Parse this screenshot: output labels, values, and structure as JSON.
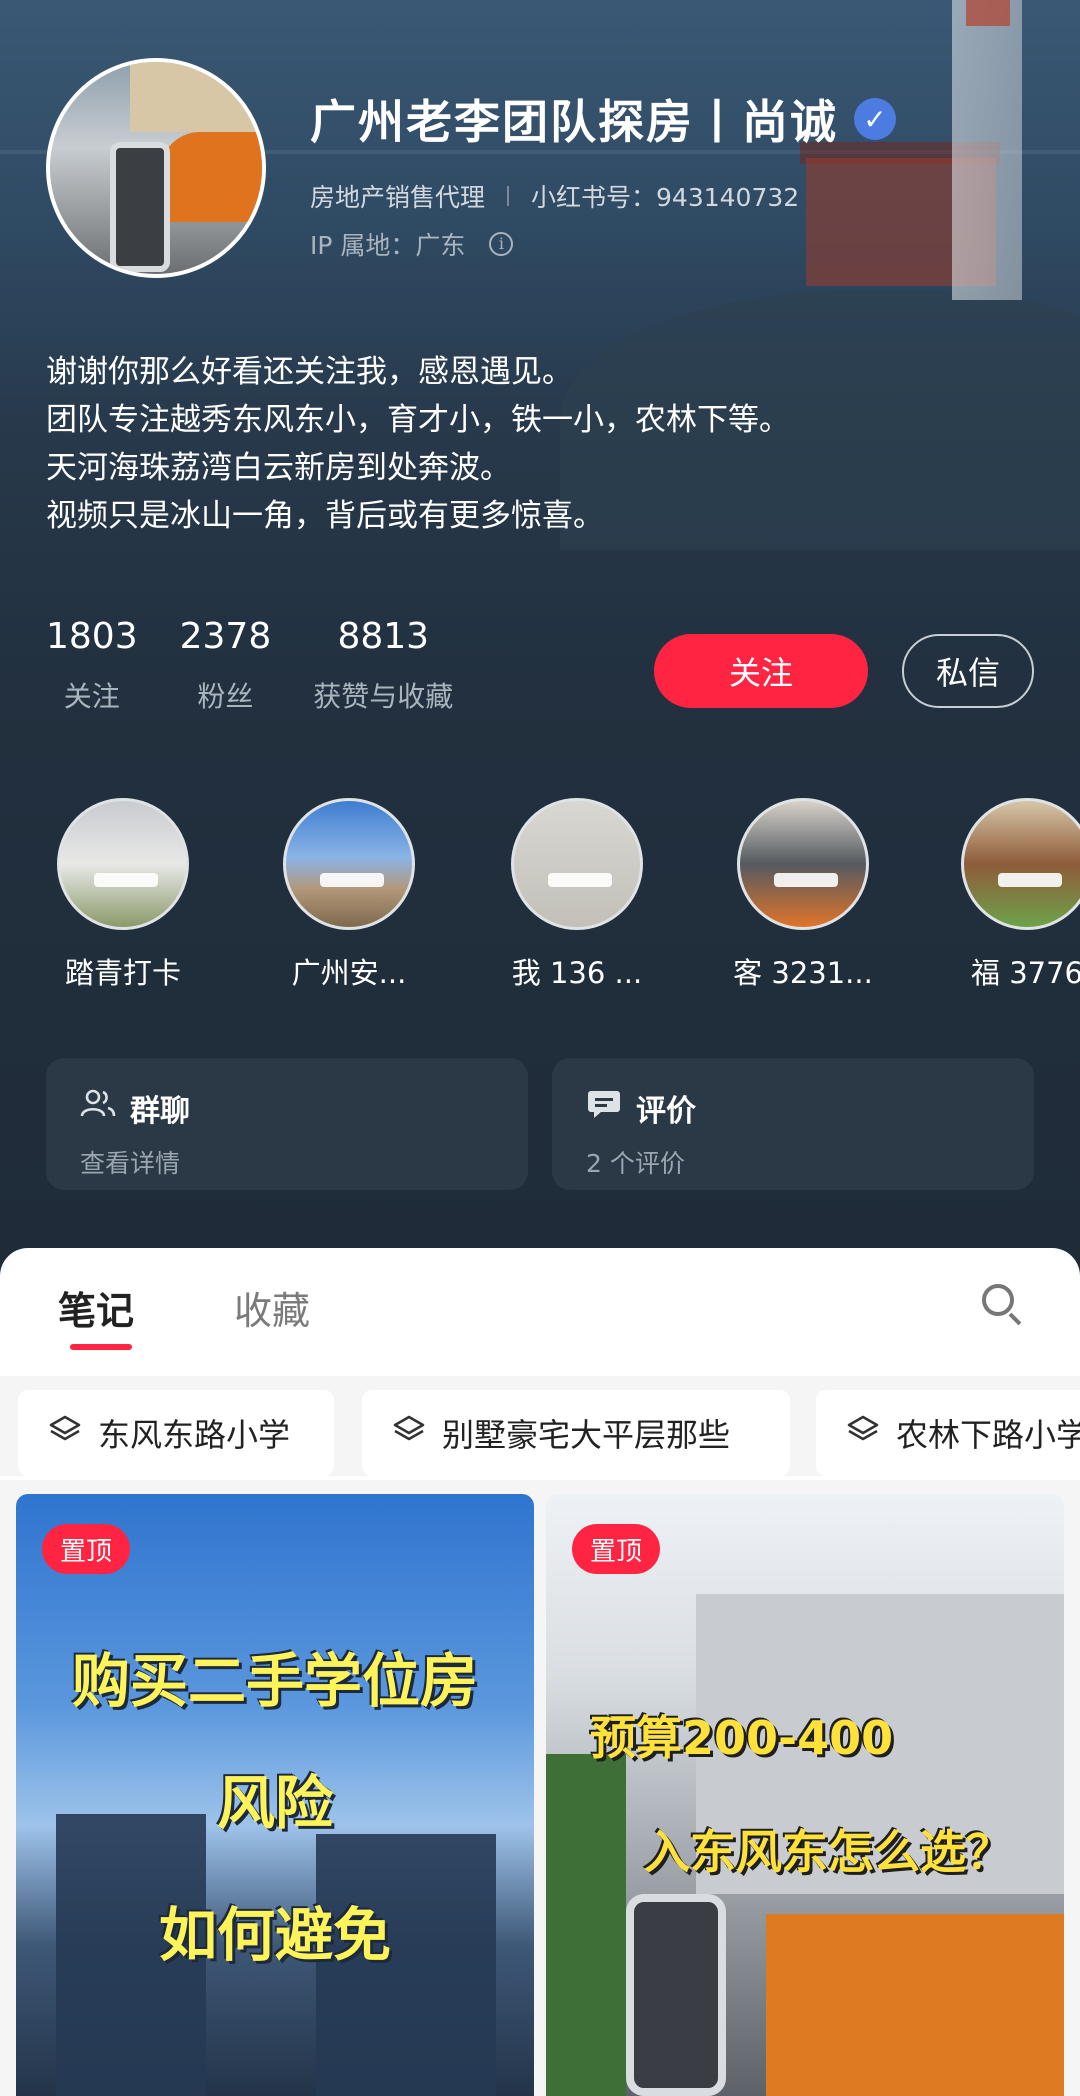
{
  "profile": {
    "name": "广州老李团队探房丨尚诚",
    "verified_mark": "✓",
    "occupation": "房地产销售代理",
    "redbook_id": "小红书号：943140732",
    "ip_location": "IP 属地：广东",
    "info_icon_glyph": "i",
    "bio": [
      "谢谢你那么好看还关注我，感恩遇见。",
      "团队专注越秀东风东小，育才小，铁一小，农林下等。",
      "天河海珠荔湾白云新房到处奔波。",
      "视频只是冰山一角，背后或有更多惊喜。"
    ]
  },
  "stats": [
    {
      "value": "1803",
      "label": "关注"
    },
    {
      "value": "2378",
      "label": "粉丝"
    },
    {
      "value": "8813",
      "label": "获赞与收藏"
    }
  ],
  "actions": {
    "follow_label": "关注",
    "message_label": "私信"
  },
  "highlights": [
    {
      "label": "踏青打卡"
    },
    {
      "label": "广州安..."
    },
    {
      "label": "我 136 ..."
    },
    {
      "label": "客 3231..."
    },
    {
      "label": "福 3776"
    }
  ],
  "cards": {
    "group_chat": {
      "icon": "group-icon",
      "title": "群聊",
      "subtitle": "查看详情"
    },
    "reviews": {
      "icon": "comment-icon",
      "title": "评价",
      "subtitle": "2 个评价"
    }
  },
  "tabs": [
    {
      "label": "笔记",
      "active": true
    },
    {
      "label": "收藏",
      "active": false
    }
  ],
  "collections": [
    {
      "label": "东风东路小学",
      "icon": "layers-icon"
    },
    {
      "label": "别墅豪宅大平层那些",
      "icon": "layers-icon"
    },
    {
      "label": "农林下路小学",
      "icon": "layers-icon"
    }
  ],
  "notes": [
    {
      "pin_label": "置顶",
      "cover_lines": [
        "购买二手学位房",
        "风险",
        "如何避免"
      ]
    },
    {
      "pin_label": "置顶",
      "cover_lines": [
        "预算200-400",
        "入东风东怎么选？"
      ]
    }
  ],
  "colors": {
    "accent": "#ff2442",
    "verified": "#4c7ce0",
    "header_bg": "#1f2c38",
    "card_bg": "#2b3946"
  }
}
